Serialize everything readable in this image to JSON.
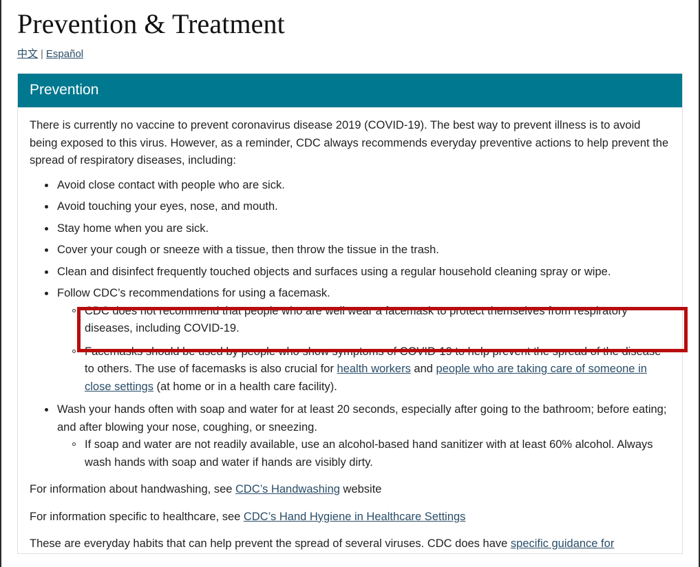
{
  "page": {
    "title": "Prevention & Treatment"
  },
  "languages": {
    "chinese": "中文",
    "separator": "|",
    "spanish": "Español"
  },
  "card": {
    "header": "Prevention",
    "intro": "There is currently no vaccine to prevent coronavirus disease 2019 (COVID-19). The best way to prevent illness is to avoid being exposed to this virus. However, as a reminder, CDC always recommends everyday preventive actions to help prevent the spread of respiratory diseases, including:",
    "bullets": [
      {
        "text": "Avoid close contact with people who are sick."
      },
      {
        "text": "Avoid touching your eyes, nose, and mouth."
      },
      {
        "text": "Stay home when you are sick."
      },
      {
        "text": "Cover your cough or sneeze with a tissue, then throw the tissue in the trash."
      },
      {
        "text": "Clean and disinfect frequently touched objects and surfaces using a regular household cleaning spray or wipe."
      },
      {
        "text": "Follow CDC’s recommendations for using a facemask."
      }
    ],
    "facemask_sub": {
      "highlighted": "CDC does not recommend that people who are well wear a facemask to protect themselves from respiratory diseases, including COVID-19.",
      "second_part_1": "Facemasks should be used by people who show symptoms of COVID-19 to help prevent the spread of the disease to  others. The use of facemasks is also crucial for ",
      "link_health_workers": "health workers",
      "second_part_2": " and ",
      "link_close_settings": "people who are taking care of someone in close settings",
      "second_part_3": " (at home or in a health care facility)."
    },
    "handwashing_bullet": "Wash your hands often with soap and water for at least 20 seconds, especially after going to the bathroom; before eating; and after blowing your nose, coughing, or sneezing.",
    "handwashing_sub": "If soap and water are not readily available, use an alcohol-based hand sanitizer with at least 60% alcohol. Always wash hands with soap and water if hands are visibly dirty.",
    "tail_paragraphs": {
      "p1_before": "For information about handwashing, see ",
      "p1_link": "CDC’s Handwashing",
      "p1_after": " website",
      "p2_before": "For information specific to healthcare, see ",
      "p2_link": "CDC’s Hand Hygiene in Healthcare Settings",
      "p2_after": "",
      "p3_before": "These are everyday habits that can help prevent the spread of several viruses. CDC does have ",
      "p3_link": "specific guidance for",
      "p3_after": ""
    }
  },
  "annotation": {
    "highlight_color": "#b80d0d",
    "header_color": "#00788f",
    "link_color": "#2a4d68"
  }
}
